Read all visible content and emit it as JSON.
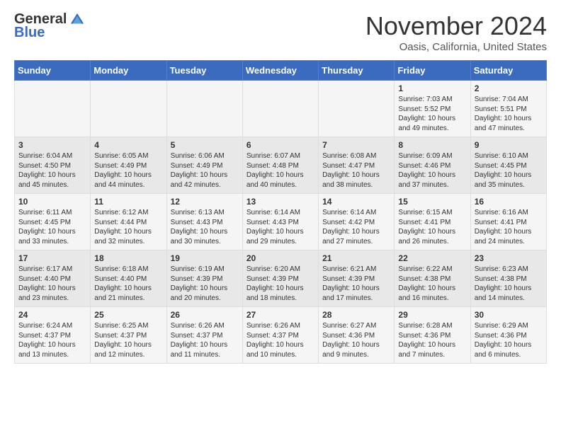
{
  "header": {
    "logo_general": "General",
    "logo_blue": "Blue",
    "month_title": "November 2024",
    "location": "Oasis, California, United States"
  },
  "weekdays": [
    "Sunday",
    "Monday",
    "Tuesday",
    "Wednesday",
    "Thursday",
    "Friday",
    "Saturday"
  ],
  "weeks": [
    [
      {
        "day": "",
        "info": ""
      },
      {
        "day": "",
        "info": ""
      },
      {
        "day": "",
        "info": ""
      },
      {
        "day": "",
        "info": ""
      },
      {
        "day": "",
        "info": ""
      },
      {
        "day": "1",
        "info": "Sunrise: 7:03 AM\nSunset: 5:52 PM\nDaylight: 10 hours\nand 49 minutes."
      },
      {
        "day": "2",
        "info": "Sunrise: 7:04 AM\nSunset: 5:51 PM\nDaylight: 10 hours\nand 47 minutes."
      }
    ],
    [
      {
        "day": "3",
        "info": "Sunrise: 6:04 AM\nSunset: 4:50 PM\nDaylight: 10 hours\nand 45 minutes."
      },
      {
        "day": "4",
        "info": "Sunrise: 6:05 AM\nSunset: 4:49 PM\nDaylight: 10 hours\nand 44 minutes."
      },
      {
        "day": "5",
        "info": "Sunrise: 6:06 AM\nSunset: 4:49 PM\nDaylight: 10 hours\nand 42 minutes."
      },
      {
        "day": "6",
        "info": "Sunrise: 6:07 AM\nSunset: 4:48 PM\nDaylight: 10 hours\nand 40 minutes."
      },
      {
        "day": "7",
        "info": "Sunrise: 6:08 AM\nSunset: 4:47 PM\nDaylight: 10 hours\nand 38 minutes."
      },
      {
        "day": "8",
        "info": "Sunrise: 6:09 AM\nSunset: 4:46 PM\nDaylight: 10 hours\nand 37 minutes."
      },
      {
        "day": "9",
        "info": "Sunrise: 6:10 AM\nSunset: 4:45 PM\nDaylight: 10 hours\nand 35 minutes."
      }
    ],
    [
      {
        "day": "10",
        "info": "Sunrise: 6:11 AM\nSunset: 4:45 PM\nDaylight: 10 hours\nand 33 minutes."
      },
      {
        "day": "11",
        "info": "Sunrise: 6:12 AM\nSunset: 4:44 PM\nDaylight: 10 hours\nand 32 minutes."
      },
      {
        "day": "12",
        "info": "Sunrise: 6:13 AM\nSunset: 4:43 PM\nDaylight: 10 hours\nand 30 minutes."
      },
      {
        "day": "13",
        "info": "Sunrise: 6:14 AM\nSunset: 4:43 PM\nDaylight: 10 hours\nand 29 minutes."
      },
      {
        "day": "14",
        "info": "Sunrise: 6:14 AM\nSunset: 4:42 PM\nDaylight: 10 hours\nand 27 minutes."
      },
      {
        "day": "15",
        "info": "Sunrise: 6:15 AM\nSunset: 4:41 PM\nDaylight: 10 hours\nand 26 minutes."
      },
      {
        "day": "16",
        "info": "Sunrise: 6:16 AM\nSunset: 4:41 PM\nDaylight: 10 hours\nand 24 minutes."
      }
    ],
    [
      {
        "day": "17",
        "info": "Sunrise: 6:17 AM\nSunset: 4:40 PM\nDaylight: 10 hours\nand 23 minutes."
      },
      {
        "day": "18",
        "info": "Sunrise: 6:18 AM\nSunset: 4:40 PM\nDaylight: 10 hours\nand 21 minutes."
      },
      {
        "day": "19",
        "info": "Sunrise: 6:19 AM\nSunset: 4:39 PM\nDaylight: 10 hours\nand 20 minutes."
      },
      {
        "day": "20",
        "info": "Sunrise: 6:20 AM\nSunset: 4:39 PM\nDaylight: 10 hours\nand 18 minutes."
      },
      {
        "day": "21",
        "info": "Sunrise: 6:21 AM\nSunset: 4:39 PM\nDaylight: 10 hours\nand 17 minutes."
      },
      {
        "day": "22",
        "info": "Sunrise: 6:22 AM\nSunset: 4:38 PM\nDaylight: 10 hours\nand 16 minutes."
      },
      {
        "day": "23",
        "info": "Sunrise: 6:23 AM\nSunset: 4:38 PM\nDaylight: 10 hours\nand 14 minutes."
      }
    ],
    [
      {
        "day": "24",
        "info": "Sunrise: 6:24 AM\nSunset: 4:37 PM\nDaylight: 10 hours\nand 13 minutes."
      },
      {
        "day": "25",
        "info": "Sunrise: 6:25 AM\nSunset: 4:37 PM\nDaylight: 10 hours\nand 12 minutes."
      },
      {
        "day": "26",
        "info": "Sunrise: 6:26 AM\nSunset: 4:37 PM\nDaylight: 10 hours\nand 11 minutes."
      },
      {
        "day": "27",
        "info": "Sunrise: 6:26 AM\nSunset: 4:37 PM\nDaylight: 10 hours\nand 10 minutes."
      },
      {
        "day": "28",
        "info": "Sunrise: 6:27 AM\nSunset: 4:36 PM\nDaylight: 10 hours\nand 9 minutes."
      },
      {
        "day": "29",
        "info": "Sunrise: 6:28 AM\nSunset: 4:36 PM\nDaylight: 10 hours\nand 7 minutes."
      },
      {
        "day": "30",
        "info": "Sunrise: 6:29 AM\nSunset: 4:36 PM\nDaylight: 10 hours\nand 6 minutes."
      }
    ]
  ]
}
